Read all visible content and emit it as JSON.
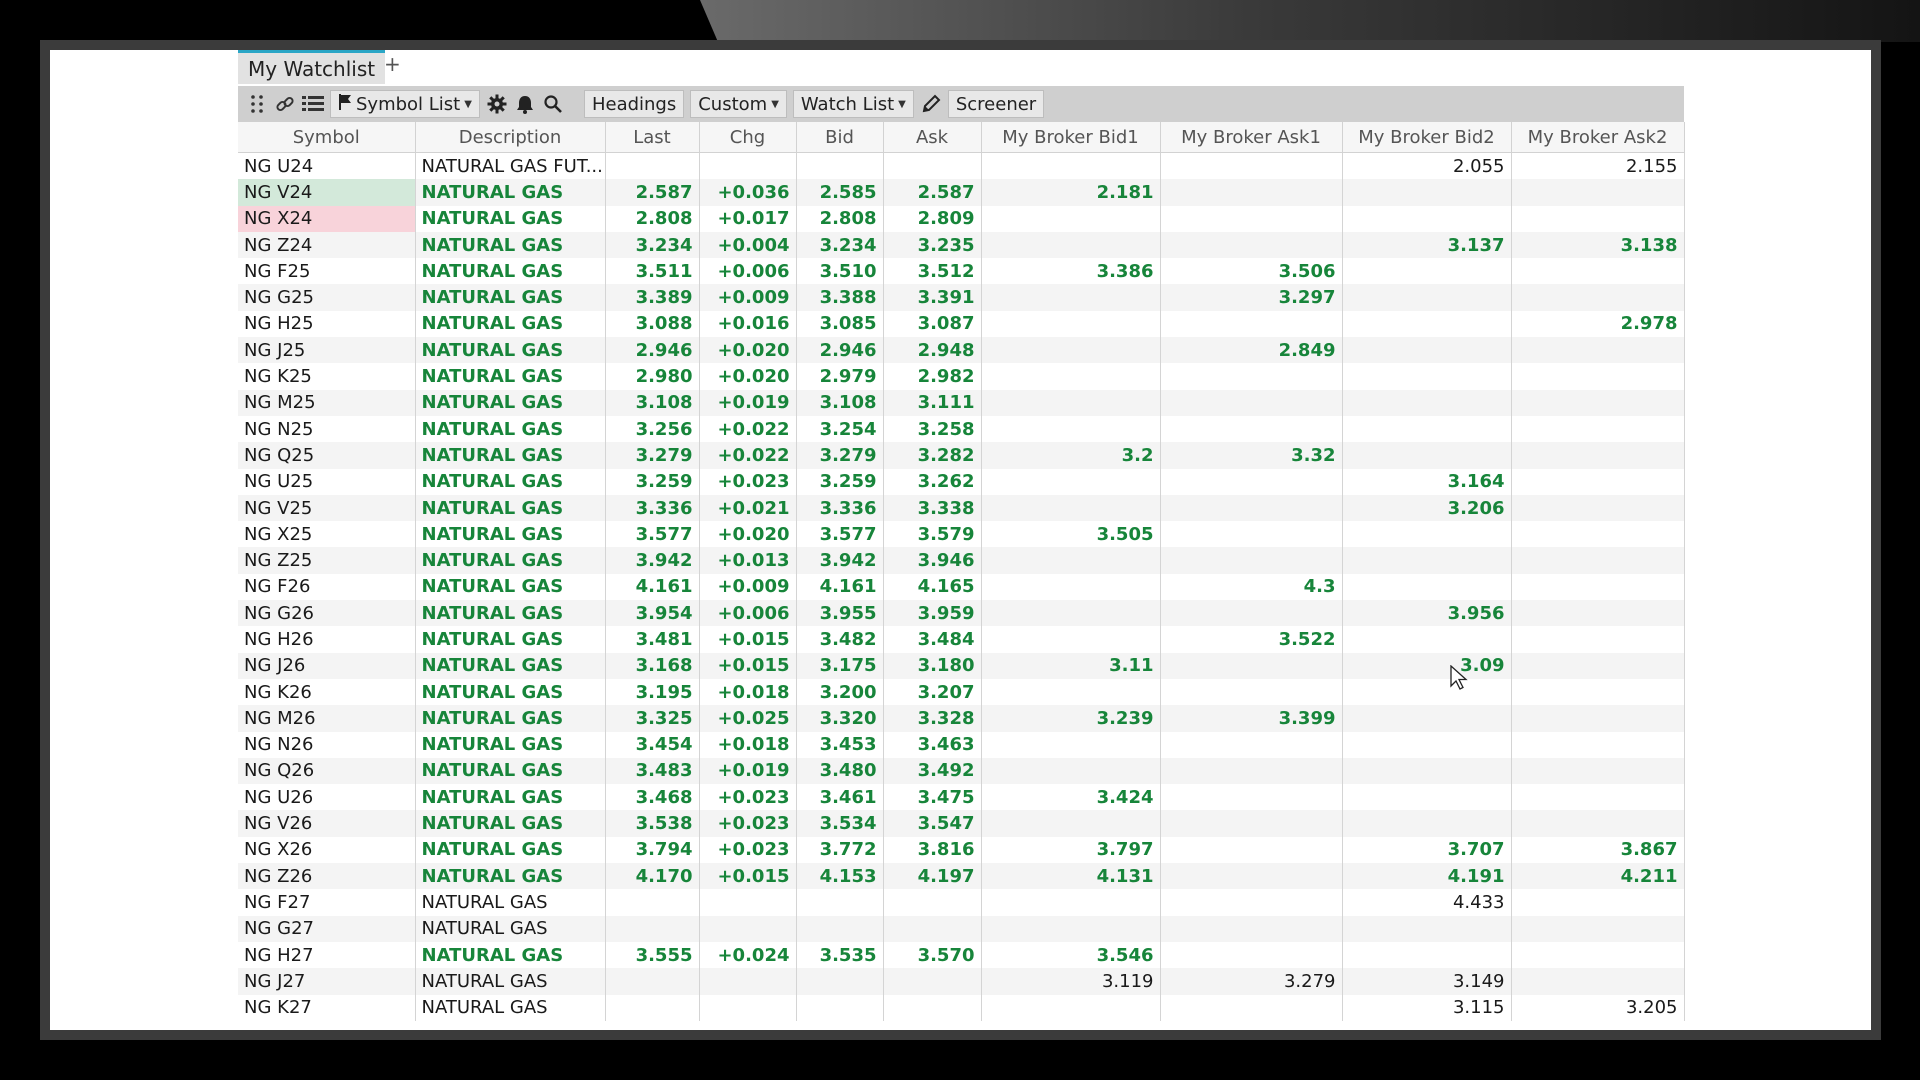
{
  "tab": {
    "label": "My Watchlist",
    "add": "+"
  },
  "toolbar": {
    "symbol_list": "Symbol List",
    "headings": "Headings",
    "custom": "Custom",
    "watch_list": "Watch List",
    "screener": "Screener"
  },
  "colors": {
    "up": "#17853a",
    "tab_accent": "#2aa6c6"
  },
  "icons": [
    "grip-icon",
    "link-icon",
    "list-icon",
    "flag-icon",
    "caret-down-icon",
    "gear-icon",
    "bell-icon",
    "search-icon",
    "pencil-icon",
    "mouse-cursor-icon"
  ],
  "columns": [
    "Symbol",
    "Description",
    "Last",
    "Chg",
    "Bid",
    "Ask",
    "My Broker Bid1",
    "My Broker Ask1",
    "My Broker Bid2",
    "My Broker Ask2"
  ],
  "rows": [
    {
      "cells": [
        "NG U24",
        "NATURAL GAS FUT...",
        "",
        "",
        "",
        "",
        "",
        "",
        "2.055",
        "2.155"
      ],
      "active": false,
      "highlight": ""
    },
    {
      "cells": [
        "NG V24",
        "NATURAL GAS",
        "2.587",
        "+0.036",
        "2.585",
        "2.587",
        "2.181",
        "",
        "",
        ""
      ],
      "active": true,
      "highlight": "green"
    },
    {
      "cells": [
        "NG X24",
        "NATURAL GAS",
        "2.808",
        "+0.017",
        "2.808",
        "2.809",
        "",
        "",
        "",
        ""
      ],
      "active": true,
      "highlight": "pink"
    },
    {
      "cells": [
        "NG Z24",
        "NATURAL GAS",
        "3.234",
        "+0.004",
        "3.234",
        "3.235",
        "",
        "",
        "3.137",
        "3.138"
      ],
      "active": true,
      "highlight": ""
    },
    {
      "cells": [
        "NG F25",
        "NATURAL GAS",
        "3.511",
        "+0.006",
        "3.510",
        "3.512",
        "3.386",
        "3.506",
        "",
        ""
      ],
      "active": true,
      "highlight": ""
    },
    {
      "cells": [
        "NG G25",
        "NATURAL GAS",
        "3.389",
        "+0.009",
        "3.388",
        "3.391",
        "",
        "3.297",
        "",
        ""
      ],
      "active": true,
      "highlight": ""
    },
    {
      "cells": [
        "NG H25",
        "NATURAL GAS",
        "3.088",
        "+0.016",
        "3.085",
        "3.087",
        "",
        "",
        "",
        "2.978"
      ],
      "active": true,
      "highlight": ""
    },
    {
      "cells": [
        "NG J25",
        "NATURAL GAS",
        "2.946",
        "+0.020",
        "2.946",
        "2.948",
        "",
        "2.849",
        "",
        ""
      ],
      "active": true,
      "highlight": ""
    },
    {
      "cells": [
        "NG K25",
        "NATURAL GAS",
        "2.980",
        "+0.020",
        "2.979",
        "2.982",
        "",
        "",
        "",
        ""
      ],
      "active": true,
      "highlight": ""
    },
    {
      "cells": [
        "NG M25",
        "NATURAL GAS",
        "3.108",
        "+0.019",
        "3.108",
        "3.111",
        "",
        "",
        "",
        ""
      ],
      "active": true,
      "highlight": ""
    },
    {
      "cells": [
        "NG N25",
        "NATURAL GAS",
        "3.256",
        "+0.022",
        "3.254",
        "3.258",
        "",
        "",
        "",
        ""
      ],
      "active": true,
      "highlight": ""
    },
    {
      "cells": [
        "NG Q25",
        "NATURAL GAS",
        "3.279",
        "+0.022",
        "3.279",
        "3.282",
        "3.2",
        "3.32",
        "",
        ""
      ],
      "active": true,
      "highlight": ""
    },
    {
      "cells": [
        "NG U25",
        "NATURAL GAS",
        "3.259",
        "+0.023",
        "3.259",
        "3.262",
        "",
        "",
        "3.164",
        ""
      ],
      "active": true,
      "highlight": ""
    },
    {
      "cells": [
        "NG V25",
        "NATURAL GAS",
        "3.336",
        "+0.021",
        "3.336",
        "3.338",
        "",
        "",
        "3.206",
        ""
      ],
      "active": true,
      "highlight": ""
    },
    {
      "cells": [
        "NG X25",
        "NATURAL GAS",
        "3.577",
        "+0.020",
        "3.577",
        "3.579",
        "3.505",
        "",
        "",
        ""
      ],
      "active": true,
      "highlight": ""
    },
    {
      "cells": [
        "NG Z25",
        "NATURAL GAS",
        "3.942",
        "+0.013",
        "3.942",
        "3.946",
        "",
        "",
        "",
        ""
      ],
      "active": true,
      "highlight": ""
    },
    {
      "cells": [
        "NG F26",
        "NATURAL GAS",
        "4.161",
        "+0.009",
        "4.161",
        "4.165",
        "",
        "4.3",
        "",
        ""
      ],
      "active": true,
      "highlight": ""
    },
    {
      "cells": [
        "NG G26",
        "NATURAL GAS",
        "3.954",
        "+0.006",
        "3.955",
        "3.959",
        "",
        "",
        "3.956",
        ""
      ],
      "active": true,
      "highlight": ""
    },
    {
      "cells": [
        "NG H26",
        "NATURAL GAS",
        "3.481",
        "+0.015",
        "3.482",
        "3.484",
        "",
        "3.522",
        "",
        ""
      ],
      "active": true,
      "highlight": ""
    },
    {
      "cells": [
        "NG J26",
        "NATURAL GAS",
        "3.168",
        "+0.015",
        "3.175",
        "3.180",
        "3.11",
        "",
        "3.09",
        ""
      ],
      "active": true,
      "highlight": ""
    },
    {
      "cells": [
        "NG K26",
        "NATURAL GAS",
        "3.195",
        "+0.018",
        "3.200",
        "3.207",
        "",
        "",
        "",
        ""
      ],
      "active": true,
      "highlight": ""
    },
    {
      "cells": [
        "NG M26",
        "NATURAL GAS",
        "3.325",
        "+0.025",
        "3.320",
        "3.328",
        "3.239",
        "3.399",
        "",
        ""
      ],
      "active": true,
      "highlight": ""
    },
    {
      "cells": [
        "NG N26",
        "NATURAL GAS",
        "3.454",
        "+0.018",
        "3.453",
        "3.463",
        "",
        "",
        "",
        ""
      ],
      "active": true,
      "highlight": ""
    },
    {
      "cells": [
        "NG Q26",
        "NATURAL GAS",
        "3.483",
        "+0.019",
        "3.480",
        "3.492",
        "",
        "",
        "",
        ""
      ],
      "active": true,
      "highlight": ""
    },
    {
      "cells": [
        "NG U26",
        "NATURAL GAS",
        "3.468",
        "+0.023",
        "3.461",
        "3.475",
        "3.424",
        "",
        "",
        ""
      ],
      "active": true,
      "highlight": ""
    },
    {
      "cells": [
        "NG V26",
        "NATURAL GAS",
        "3.538",
        "+0.023",
        "3.534",
        "3.547",
        "",
        "",
        "",
        ""
      ],
      "active": true,
      "highlight": ""
    },
    {
      "cells": [
        "NG X26",
        "NATURAL GAS",
        "3.794",
        "+0.023",
        "3.772",
        "3.816",
        "3.797",
        "",
        "3.707",
        "3.867"
      ],
      "active": true,
      "highlight": ""
    },
    {
      "cells": [
        "NG Z26",
        "NATURAL GAS",
        "4.170",
        "+0.015",
        "4.153",
        "4.197",
        "4.131",
        "",
        "4.191",
        "4.211"
      ],
      "active": true,
      "highlight": ""
    },
    {
      "cells": [
        "NG F27",
        "NATURAL GAS",
        "",
        "",
        "",
        "",
        "",
        "",
        "4.433",
        ""
      ],
      "active": false,
      "highlight": ""
    },
    {
      "cells": [
        "NG G27",
        "NATURAL GAS",
        "",
        "",
        "",
        "",
        "",
        "",
        "",
        ""
      ],
      "active": false,
      "highlight": ""
    },
    {
      "cells": [
        "NG H27",
        "NATURAL GAS",
        "3.555",
        "+0.024",
        "3.535",
        "3.570",
        "3.546",
        "",
        "",
        ""
      ],
      "active": true,
      "highlight": ""
    },
    {
      "cells": [
        "NG J27",
        "NATURAL GAS",
        "",
        "",
        "",
        "",
        "3.119",
        "3.279",
        "3.149",
        ""
      ],
      "active": false,
      "highlight": ""
    },
    {
      "cells": [
        "NG K27",
        "NATURAL GAS",
        "",
        "",
        "",
        "",
        "",
        "",
        "3.115",
        "3.205"
      ],
      "active": false,
      "highlight": ""
    }
  ]
}
